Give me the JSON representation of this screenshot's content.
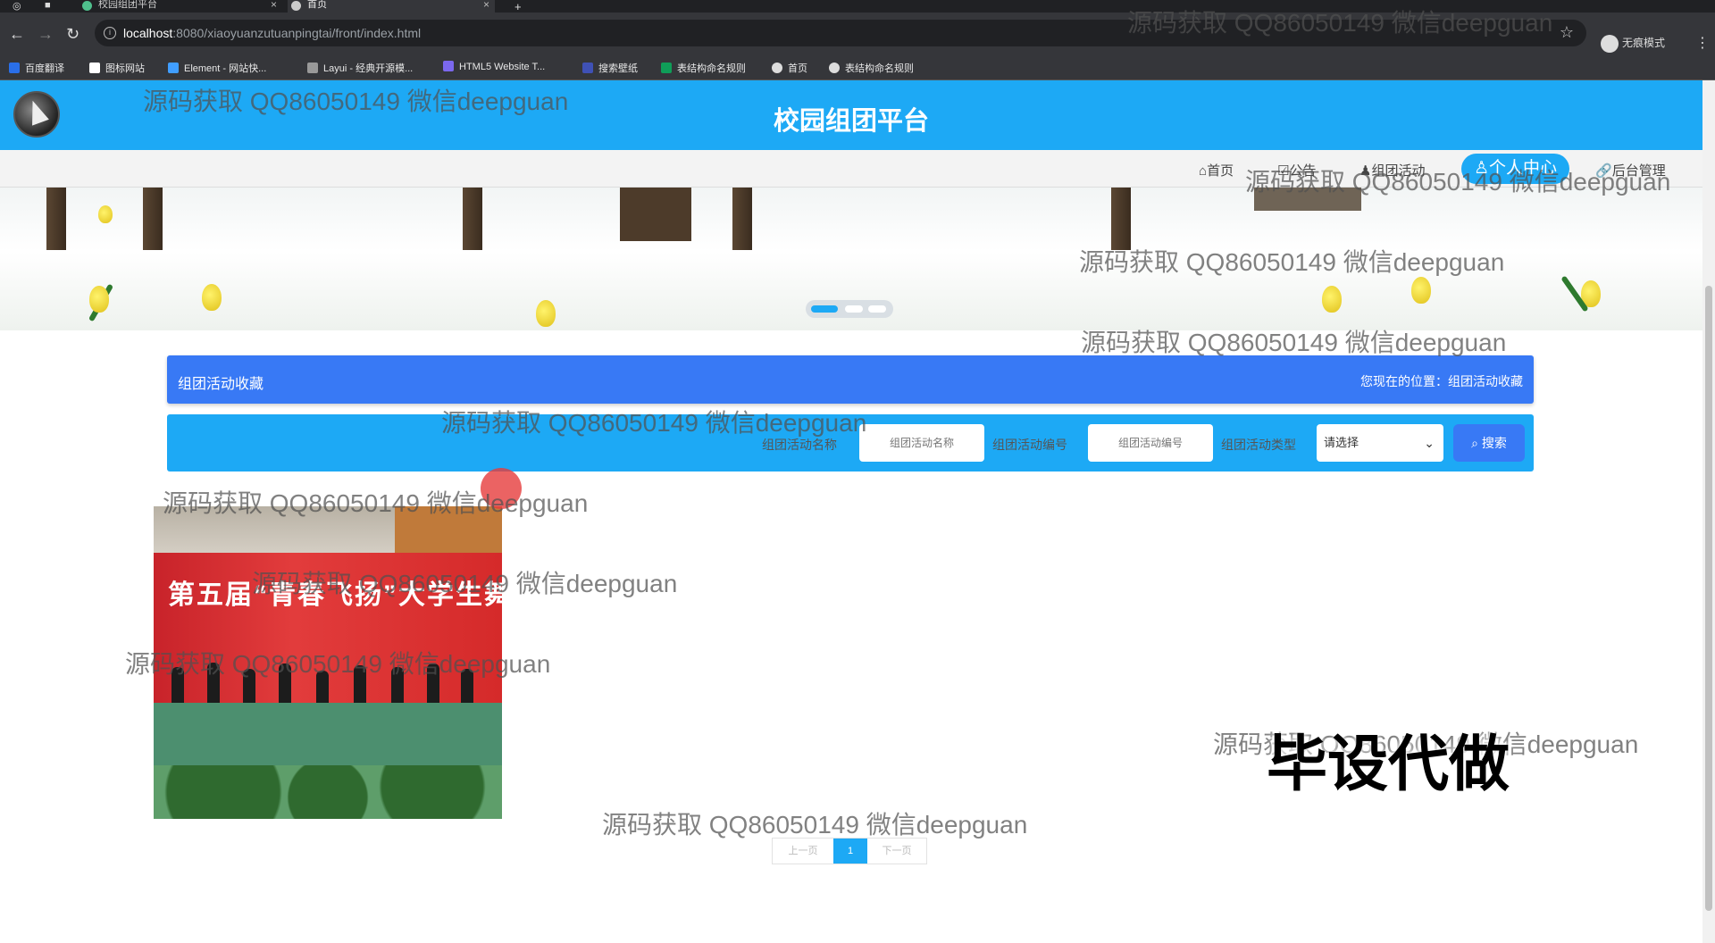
{
  "browser": {
    "tabs": [
      {
        "title": "校园组团平台",
        "icon": "vue-icon"
      },
      {
        "title": "首页",
        "icon": "globe-icon"
      }
    ],
    "url_host": "localhost",
    "url_rest": ":8080/xiaoyuanzutuanpingtai/front/index.html",
    "incognito_label": "无痕模式",
    "bookmarks": [
      "百度翻译",
      "图标网站",
      "Element - 网站快...",
      "Layui - 经典开源模...",
      "HTML5 Website T...",
      "搜索壁纸",
      "表结构命名规则",
      "首页",
      "表结构命名规则"
    ]
  },
  "header": {
    "site_title": "校园组团平台"
  },
  "nav": {
    "items": [
      "首页",
      "公告",
      "组团活动",
      "个人中心",
      "后台管理"
    ],
    "active_index": 3
  },
  "banner": {
    "slide_count": 3,
    "active_slide": 1
  },
  "breadcrumb": {
    "title": "组团活动收藏",
    "location": "您现在的位置：组团活动收藏"
  },
  "search": {
    "fields": [
      {
        "label": "组团活动名称",
        "placeholder": "组团活动名称"
      },
      {
        "label": "组团活动编号",
        "placeholder": "组团活动编号"
      }
    ],
    "type_label": "组团活动类型",
    "type_selected": "请选择",
    "button_label": "搜索"
  },
  "card": {
    "photo_caption": "第五届“青春飞扬”大学生舞蹈大"
  },
  "pagination": {
    "prev": "上一页",
    "current": "1",
    "next": "下一页"
  },
  "watermarks": {
    "text": "源码获取 QQ86050149 微信deepguan",
    "big": "毕设代做"
  },
  "colors": {
    "primary": "#1da9f5",
    "accent": "#3879f5"
  }
}
